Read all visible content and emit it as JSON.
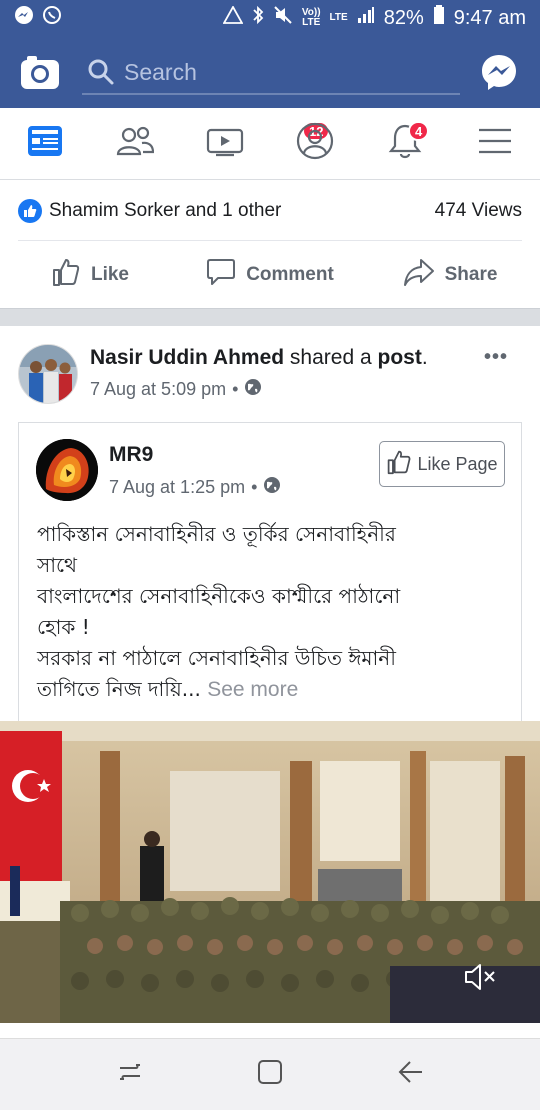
{
  "status_bar": {
    "battery": "82%",
    "time": "9:47 am",
    "volte_top": "Vo))",
    "volte_bottom": "LTE",
    "lte": "LTE"
  },
  "search": {
    "placeholder": "Search"
  },
  "nav": {
    "watch_badge": "12",
    "notifications_badge": "4"
  },
  "reactions": {
    "liked_by": "Shamim Sorker and 1 other",
    "views": "474 Views"
  },
  "actions": {
    "like": "Like",
    "comment": "Comment",
    "share": "Share"
  },
  "post": {
    "author": "Nasir Uddin Ahmed",
    "shared_text": "shared a",
    "post_word": "post",
    "time": "7 Aug at 5:09 pm",
    "more": "•••"
  },
  "shared": {
    "page_name": "MR9",
    "time": "7 Aug at 1:25 pm",
    "like_page": "Like Page",
    "lines": [
      "পাকিস্তান সেনাবাহিনীর ও তূর্কির সেনাবাহিনীর",
      "সাথে",
      "বাংলাদেশের সেনাবাহিনীকেও কাশ্মীরে পাঠানো",
      "হোক !",
      "সরকার না পাঠালে সেনাবাহিনীর উচিত ঈমানী",
      "তাগিতে নিজ দায়ি..."
    ],
    "see_more": "See more"
  },
  "colors": {
    "brand": "#3b5998",
    "like_blue": "#1877f2",
    "badge_red": "#f02849"
  }
}
